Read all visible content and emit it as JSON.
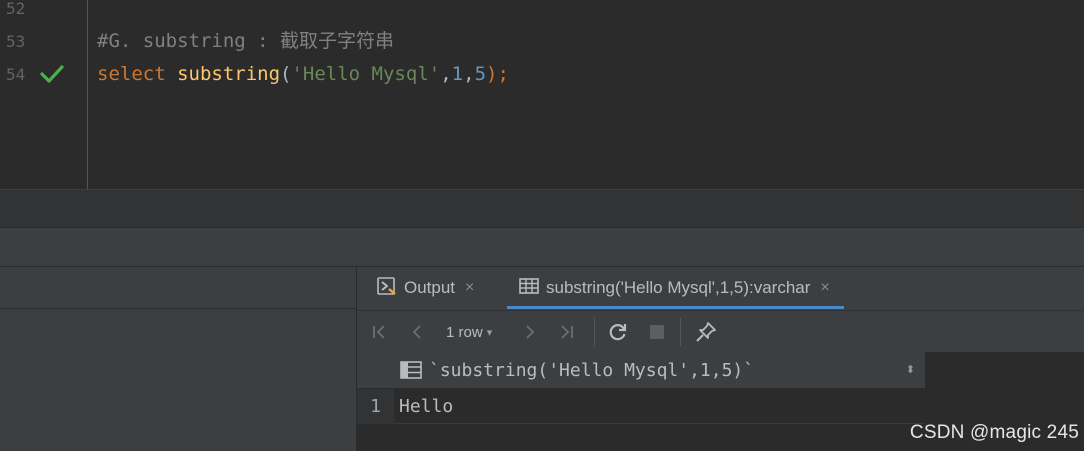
{
  "editor": {
    "lines": [
      {
        "number": "52",
        "text": ""
      },
      {
        "number": "53",
        "comment": "#G. substring : 截取子字符串"
      },
      {
        "number": "54",
        "kw": "select ",
        "fn": "substring",
        "open": "(",
        "str": "'Hello Mysql'",
        "c1": ",",
        "n1": "1",
        "c2": ",",
        "n2": "5",
        "close": ");"
      }
    ],
    "check_icon": "checkmark-icon",
    "colors": {
      "keyword": "#cc7832",
      "function": "#ffc66d",
      "string": "#6a8759",
      "number": "#6897bb",
      "comment": "#808080",
      "check": "#4caf50"
    }
  },
  "services": {
    "tabs": [
      {
        "label": "Output",
        "icon": "console-output-icon",
        "close": "×"
      },
      {
        "label": "substring('Hello Mysql',1,5):varchar",
        "icon": "table-icon",
        "close": "×",
        "active": true
      }
    ],
    "toolbar": {
      "first": "|<",
      "prev": "<",
      "rows_label": "1 row",
      "rows_chevron": "▾",
      "next": ">",
      "last": ">|",
      "refresh_icon": "refresh-icon",
      "stop_icon": "stop-icon",
      "pin_icon": "pin-icon"
    },
    "grid": {
      "column_header": "`substring('Hello Mysql',1,5)`",
      "sort_indicator": "⬍",
      "rows": [
        {
          "num": "1",
          "value": "Hello"
        }
      ]
    }
  },
  "watermark": "CSDN @magic 245"
}
